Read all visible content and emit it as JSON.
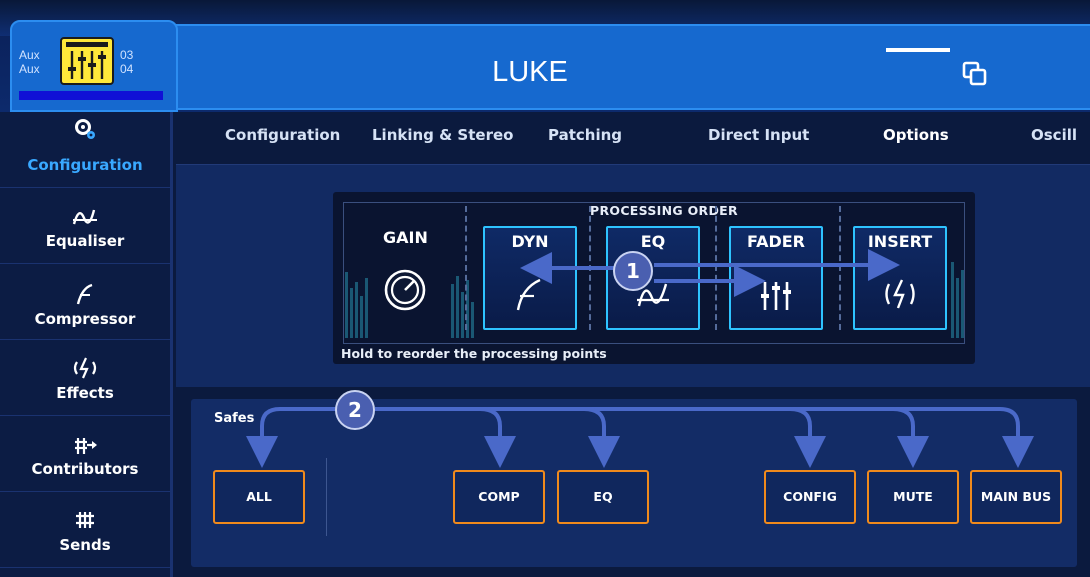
{
  "header": {
    "strip_labels": [
      "Aux",
      "Aux"
    ],
    "strip_numbers": [
      "03",
      "04"
    ],
    "title": "LUKE"
  },
  "sidebar": {
    "items": [
      {
        "label": "Configuration",
        "icon": "config-gears-icon",
        "active": true
      },
      {
        "label": "Equaliser",
        "icon": "eq-curve-icon",
        "active": false
      },
      {
        "label": "Compressor",
        "icon": "compressor-curve-icon",
        "active": false
      },
      {
        "label": "Effects",
        "icon": "effects-icon",
        "active": false
      },
      {
        "label": "Contributors",
        "icon": "contributors-icon",
        "active": false
      },
      {
        "label": "Sends",
        "icon": "sends-icon",
        "active": false
      }
    ]
  },
  "tabs": [
    {
      "label": "Configuration",
      "active": false
    },
    {
      "label": "Linking & Stereo",
      "active": false
    },
    {
      "label": "Patching",
      "active": false
    },
    {
      "label": "Direct Input",
      "active": false
    },
    {
      "label": "Options",
      "active": true
    },
    {
      "label": "Oscill",
      "active": false
    }
  ],
  "processing": {
    "title": "PROCESSING ORDER",
    "gain_label": "GAIN",
    "blocks": [
      {
        "label": "DYN",
        "icon": "dynamics-icon"
      },
      {
        "label": "EQ",
        "icon": "eq-icon"
      },
      {
        "label": "FADER",
        "icon": "fader-icon"
      },
      {
        "label": "INSERT",
        "icon": "insert-icon"
      }
    ],
    "hint": "Hold to reorder the processing points"
  },
  "safes": {
    "label": "Safes",
    "buttons": [
      "ALL",
      "COMP",
      "EQ",
      "CONFIG",
      "MUTE",
      "MAIN BUS"
    ]
  },
  "callouts": [
    "1",
    "2"
  ],
  "colors": {
    "accent_blue": "#1669cf",
    "block_border": "#2ec3ff",
    "safe_border": "#f08a1c",
    "active_sidebar": "#39a8ff",
    "badge": "#4a5fb0"
  }
}
